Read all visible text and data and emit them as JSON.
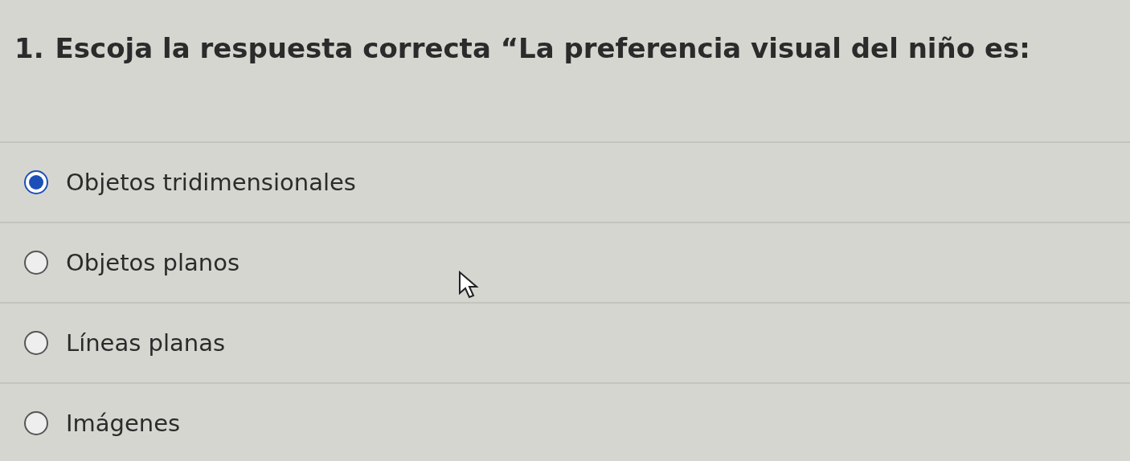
{
  "question": {
    "number": "1.",
    "text": "Escoja la respuesta correcta “La preferencia visual del niño es:"
  },
  "options": [
    {
      "label": "Objetos tridimensionales",
      "selected": true
    },
    {
      "label": "Objetos planos",
      "selected": false
    },
    {
      "label": "Líneas planas",
      "selected": false
    },
    {
      "label": "Imágenes",
      "selected": false
    }
  ]
}
